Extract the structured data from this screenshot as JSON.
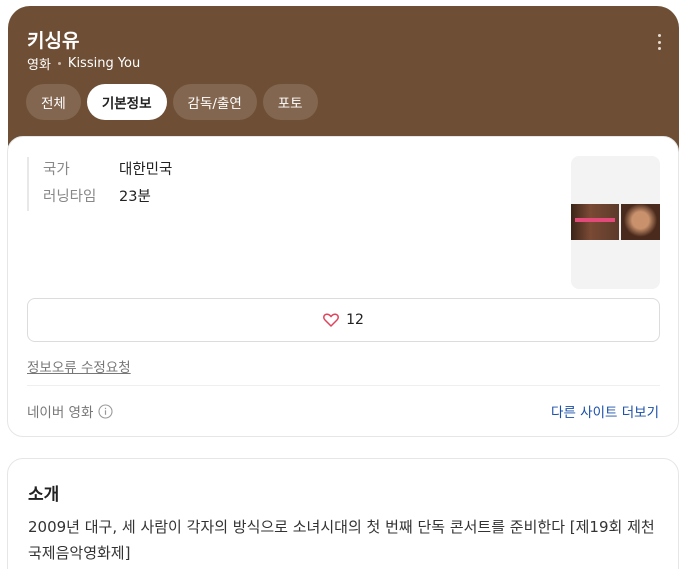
{
  "header": {
    "title": "키싱유",
    "category": "영화",
    "english_title": "Kissing You",
    "more_icon": "more-vertical-icon",
    "background_color": "#6e4f36"
  },
  "tabs": [
    {
      "label": "전체",
      "active": false
    },
    {
      "label": "기본정보",
      "active": true
    },
    {
      "label": "감독/출연",
      "active": false
    },
    {
      "label": "포토",
      "active": false
    }
  ],
  "info": {
    "country_label": "국가",
    "country_value": "대한민국",
    "runtime_label": "러닝타임",
    "runtime_value": "23분"
  },
  "like": {
    "icon": "heart-icon",
    "count": "12"
  },
  "report_link": "정보오류 수정요청",
  "source": {
    "label": "네이버 영화",
    "icon": "info-icon"
  },
  "other_sites_link": "다른 사이트 더보기",
  "intro": {
    "title": "소개",
    "text": "2009년 대구, 세 사람이 각자의 방식으로 소녀시대의 첫 번째 단독 콘서트를 준비한다 [제19회 제천국제음악영화제]"
  }
}
